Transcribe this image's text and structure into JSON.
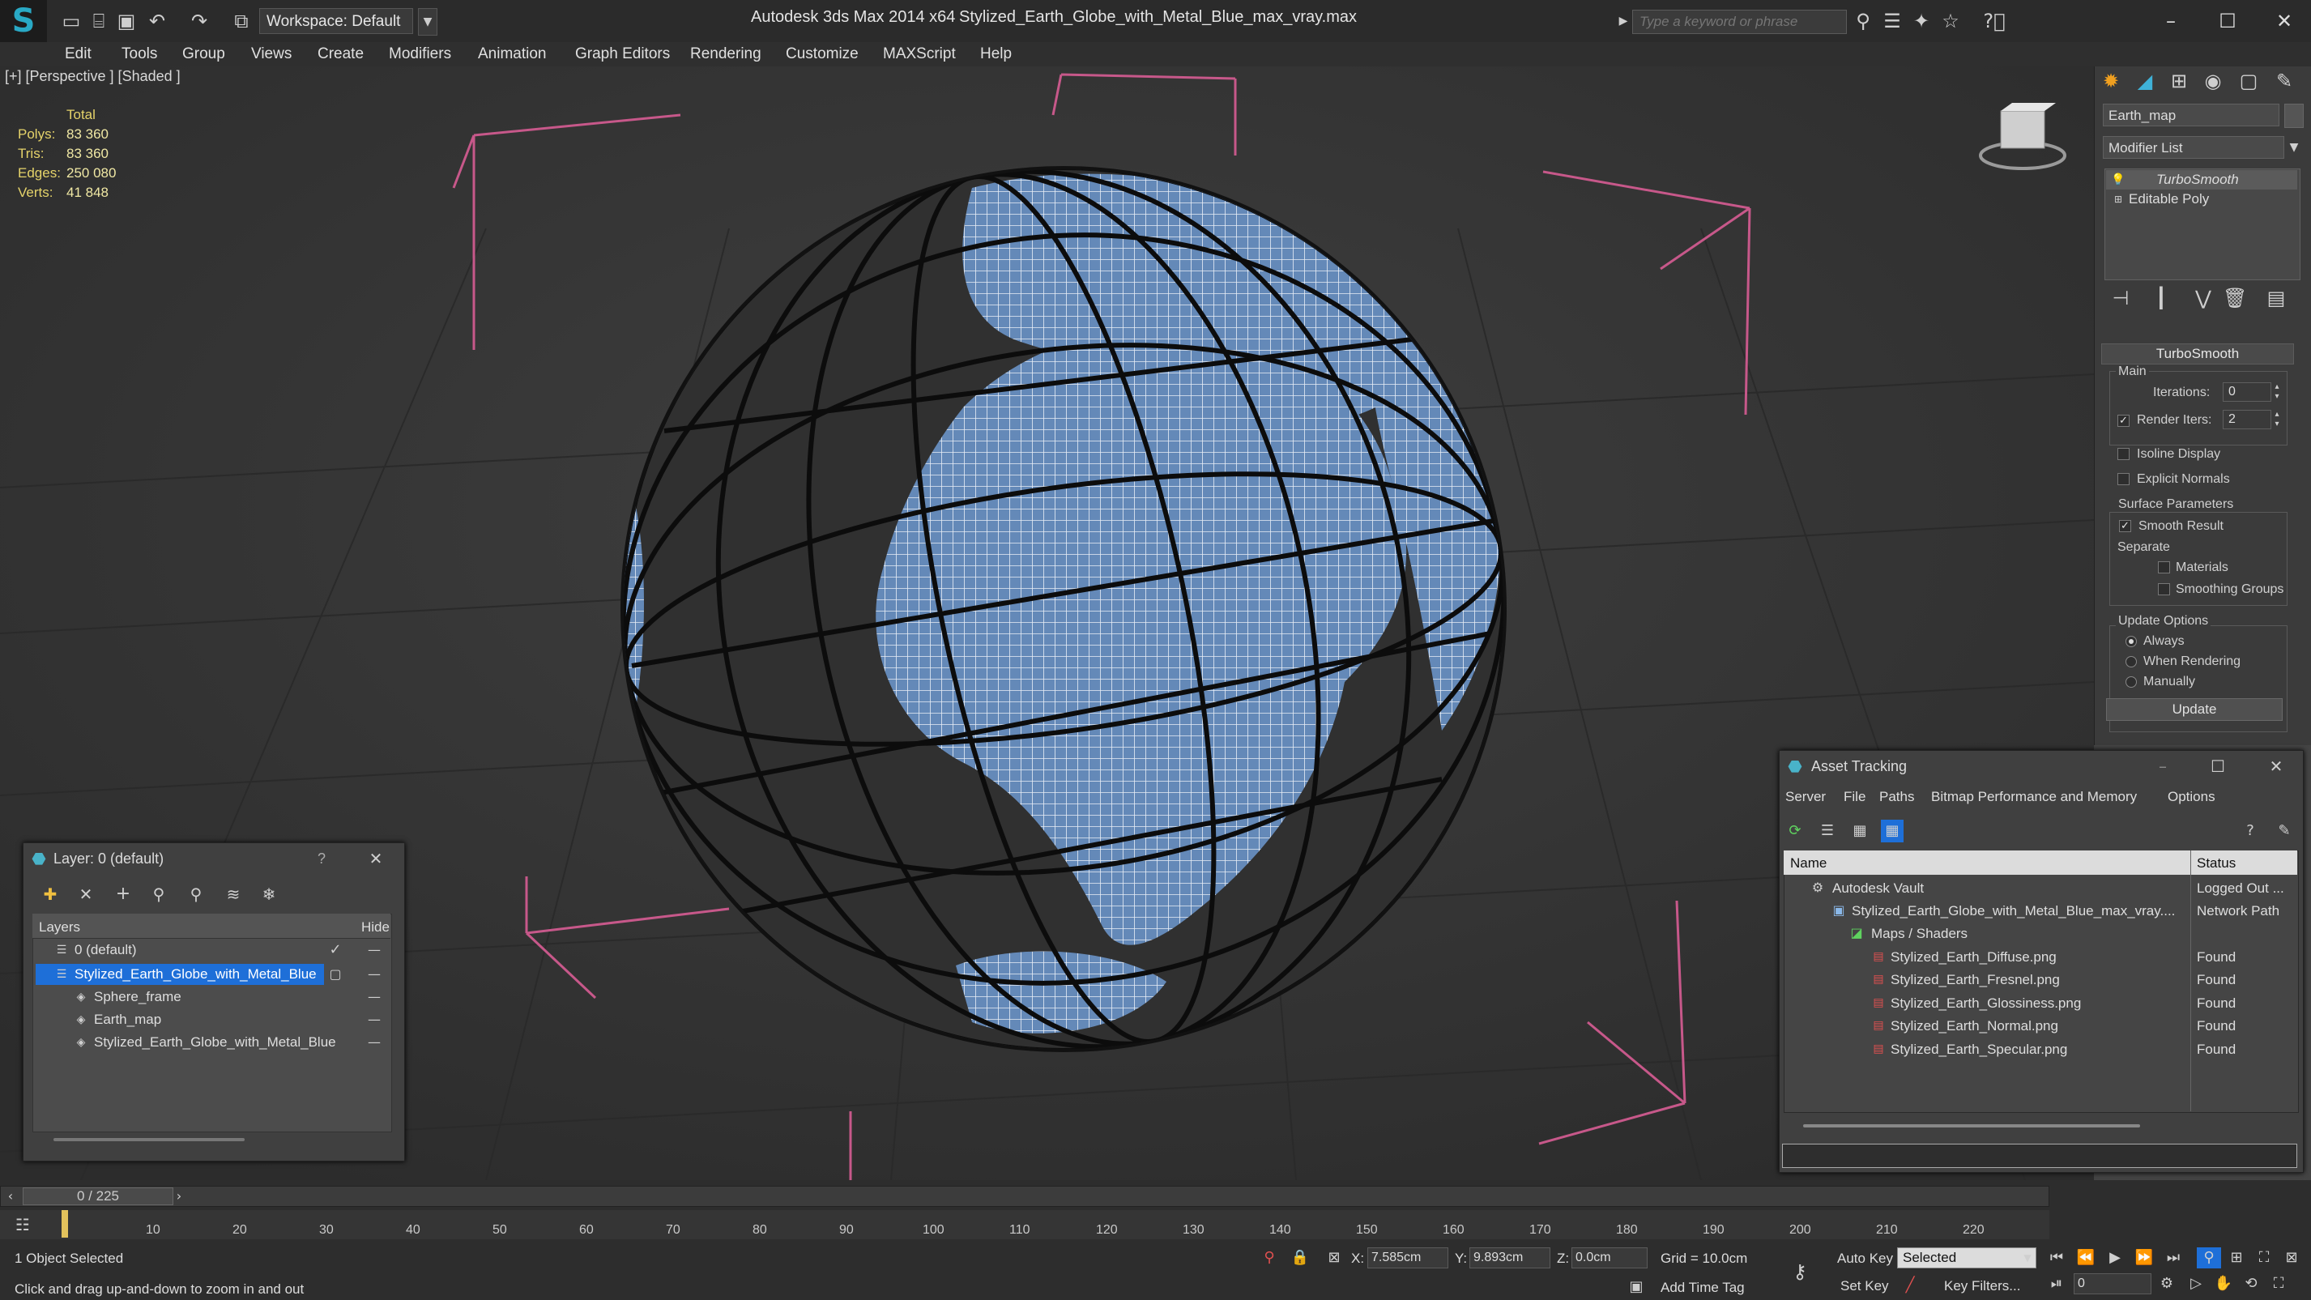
{
  "app": {
    "logo": "S",
    "workspace": "Workspace: Default",
    "app_name": "Autodesk 3ds Max  2014 x64",
    "file_name": "Stylized_Earth_Globe_with_Metal_Blue_max_vray.max",
    "search_placeholder": "Type a keyword or phrase"
  },
  "menu": [
    "Edit",
    "Tools",
    "Group",
    "Views",
    "Create",
    "Modifiers",
    "Animation",
    "Graph Editors",
    "Rendering",
    "Customize",
    "MAXScript",
    "Help"
  ],
  "viewport": {
    "label": "[+] [Perspective ] [Shaded ]",
    "stats": {
      "header": "Total",
      "rows": [
        {
          "k": "Polys:",
          "v": "83 360"
        },
        {
          "k": "Tris:",
          "v": "83 360"
        },
        {
          "k": "Edges:",
          "v": "250 080"
        },
        {
          "k": "Verts:",
          "v": "41 848"
        }
      ]
    }
  },
  "command_panel": {
    "object_name": "Earth_map",
    "modifier_list": "Modifier List",
    "stack": [
      "TurboSmooth",
      "Editable Poly"
    ],
    "rollout_title": "TurboSmooth",
    "main_label": "Main",
    "iterations_label": "Iterations:",
    "iterations_value": "0",
    "render_iters_label": "Render Iters:",
    "render_iters_value": "2",
    "isoline": "Isoline Display",
    "explicit": "Explicit Normals",
    "surface_params": "Surface Parameters",
    "smooth_result": "Smooth Result",
    "separate": "Separate",
    "materials": "Materials",
    "smoothing_groups": "Smoothing Groups",
    "update_options": "Update Options",
    "always": "Always",
    "when_rendering": "When Rendering",
    "manually": "Manually",
    "update_btn": "Update"
  },
  "layer_dialog": {
    "title": "Layer: 0 (default)",
    "help": "?",
    "col_layers": "Layers",
    "col_hide": "Hide",
    "rows": [
      {
        "name": "0 (default)",
        "indent": 0
      },
      {
        "name": "Stylized_Earth_Globe_with_Metal_Blue",
        "indent": 0
      },
      {
        "name": "Sphere_frame",
        "indent": 1
      },
      {
        "name": "Earth_map",
        "indent": 1
      },
      {
        "name": "Stylized_Earth_Globe_with_Metal_Blue",
        "indent": 1
      }
    ]
  },
  "asset_tracking": {
    "title": "Asset Tracking",
    "menu": [
      "Server",
      "File",
      "Paths",
      "Bitmap Performance and Memory",
      "Options"
    ],
    "col_name": "Name",
    "col_status": "Status",
    "rows": [
      {
        "name": "Autodesk Vault",
        "status": "Logged Out ..."
      },
      {
        "name": "Stylized_Earth_Globe_with_Metal_Blue_max_vray....",
        "status": "Network Path"
      },
      {
        "name": "Maps / Shaders",
        "status": ""
      },
      {
        "name": "Stylized_Earth_Diffuse.png",
        "status": "Found"
      },
      {
        "name": "Stylized_Earth_Fresnel.png",
        "status": "Found"
      },
      {
        "name": "Stylized_Earth_Glossiness.png",
        "status": "Found"
      },
      {
        "name": "Stylized_Earth_Normal.png",
        "status": "Found"
      },
      {
        "name": "Stylized_Earth_Specular.png",
        "status": "Found"
      }
    ]
  },
  "timeline": {
    "frame": "0 / 225",
    "ticks": [
      "10",
      "20",
      "30",
      "40",
      "50",
      "60",
      "70",
      "80",
      "90",
      "100",
      "110",
      "120",
      "130",
      "140",
      "150",
      "160",
      "170",
      "180",
      "190",
      "200",
      "210",
      "220"
    ]
  },
  "status": {
    "selected": "1 Object Selected",
    "hint": "Click and drag up-and-down to zoom in and out",
    "x_label": "X:",
    "x_value": "7.585cm",
    "y_label": "Y:",
    "y_value": "9.893cm",
    "z_label": "Z:",
    "z_value": "0.0cm",
    "grid": "Grid = 10.0cm",
    "auto_key": "Auto Key",
    "set_key": "Set Key",
    "selected_set": "Selected",
    "key_filters": "Key Filters...",
    "add_time_tag": "Add Time Tag",
    "frame_value": "0"
  },
  "colors": {
    "accent_blue": "#1e6fd8",
    "globe_fill": "#5c86b7",
    "frame_pink": "#c7588a"
  }
}
